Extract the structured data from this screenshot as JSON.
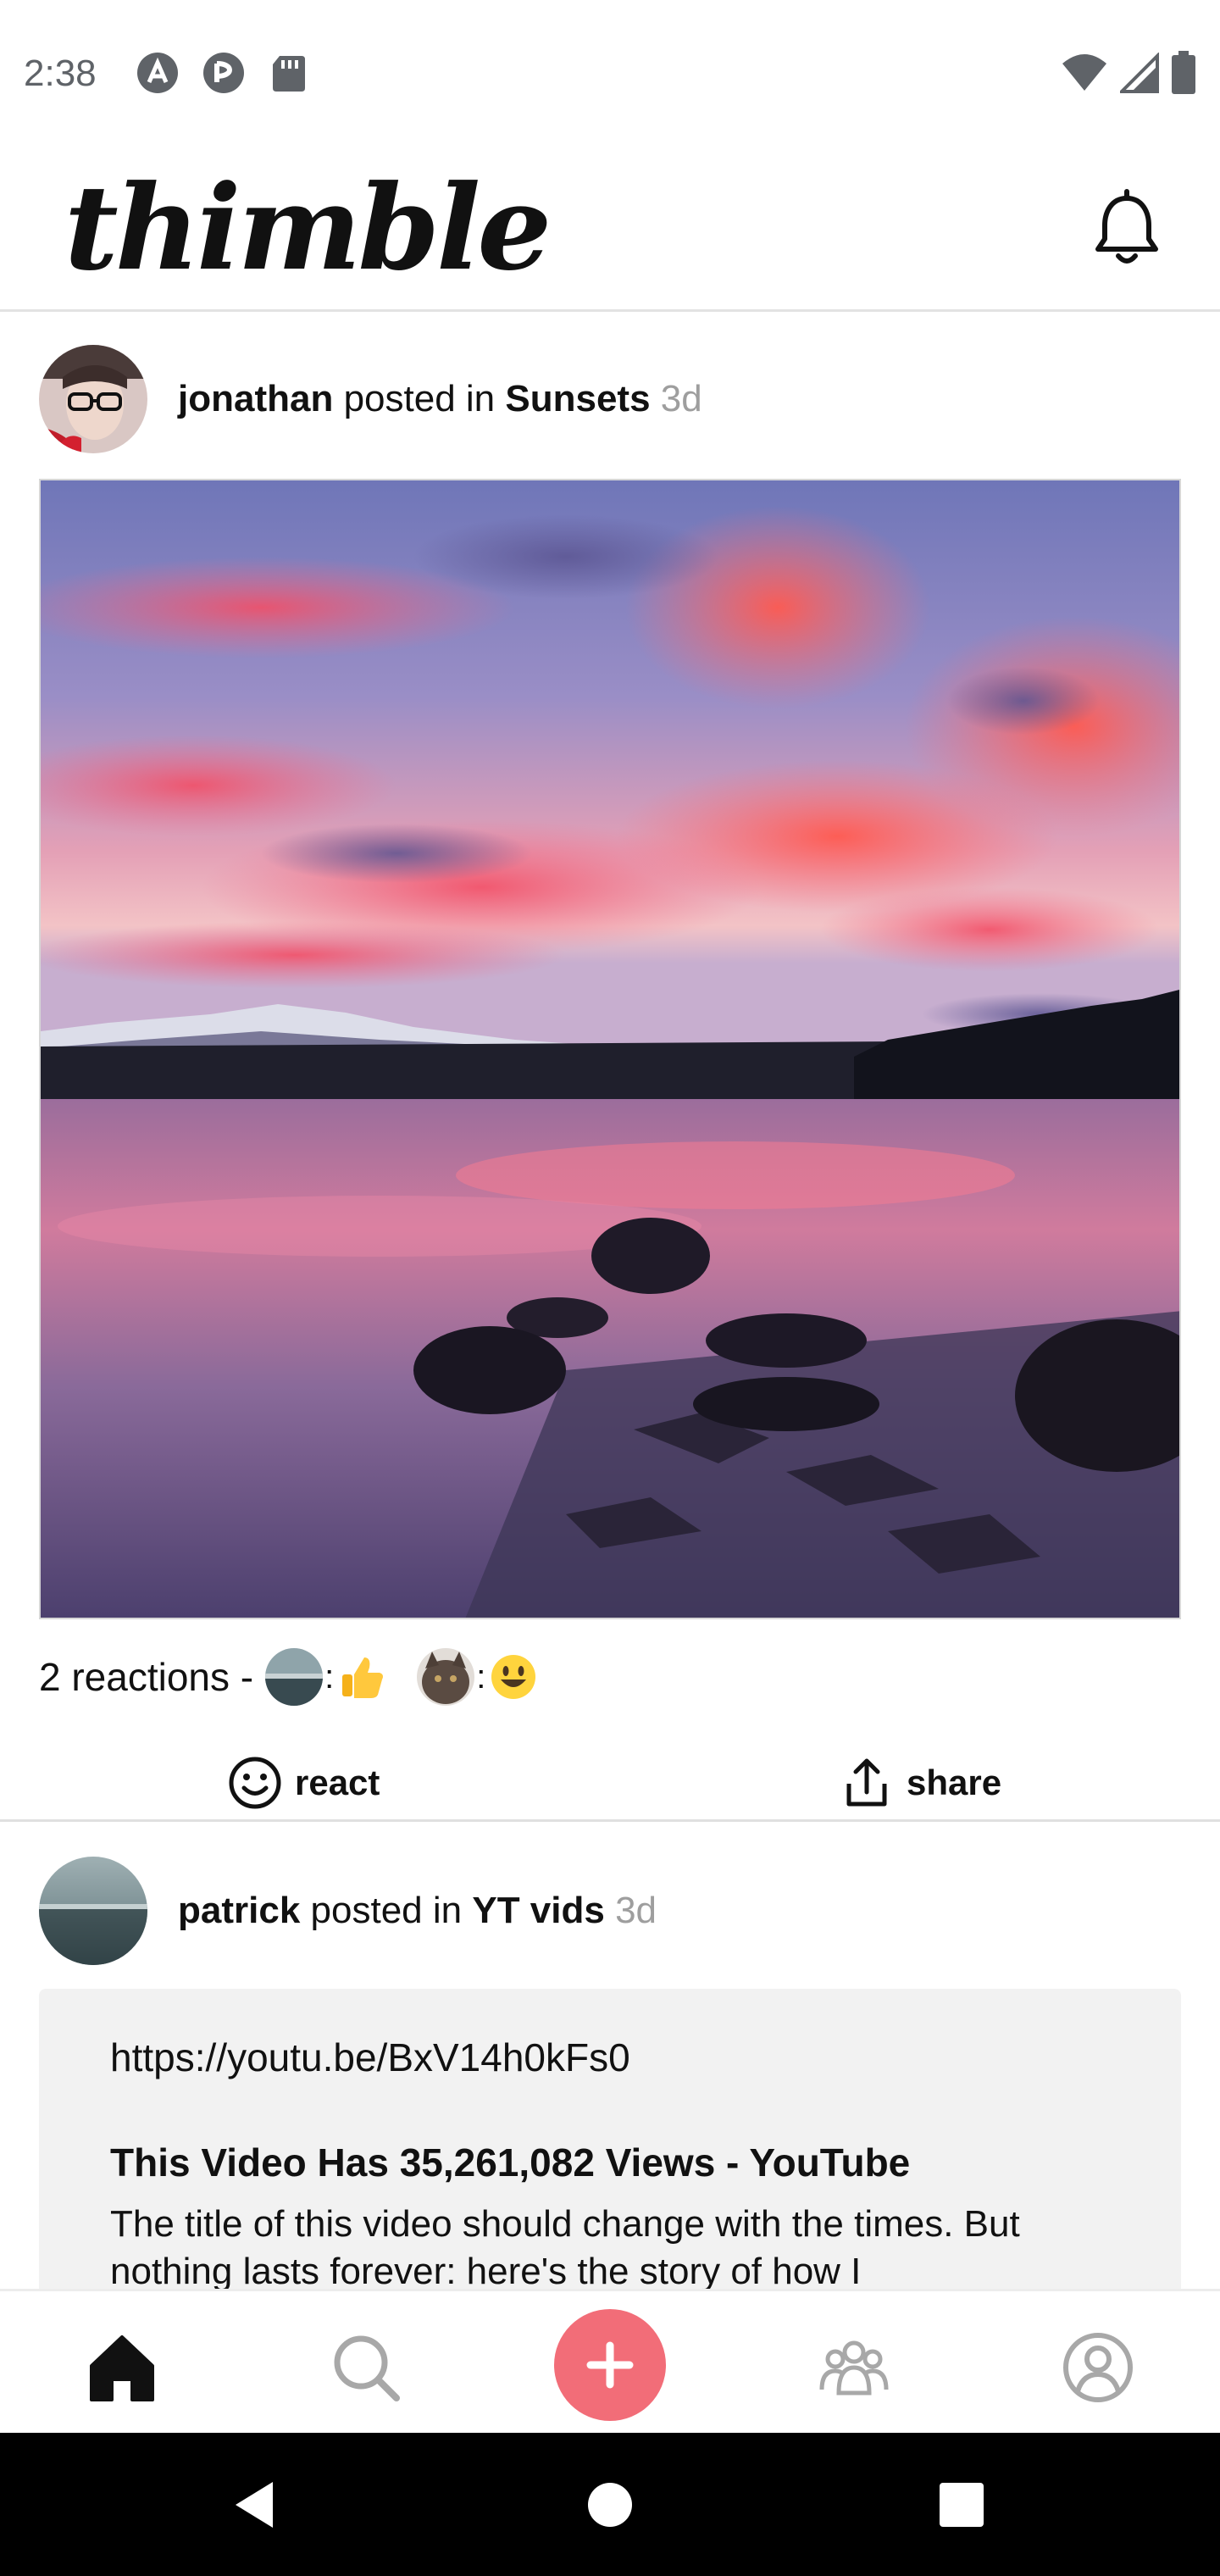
{
  "status_bar": {
    "time": "2:38"
  },
  "header": {
    "logo": "thimble"
  },
  "posts": [
    {
      "author": "jonathan",
      "posted_in": "posted in",
      "group": "Sunsets",
      "age": "3d",
      "reactions_label": "2 reactions -",
      "reactions": [
        {
          "emoji": "👍",
          "avatar": "landscape-avatar"
        },
        {
          "emoji": "😃",
          "avatar": "cat-avatar"
        }
      ],
      "react_label": "react",
      "share_label": "share"
    },
    {
      "author": "patrick",
      "posted_in": "posted in",
      "group": "YT vids",
      "age": "3d",
      "link": {
        "url": "https://youtu.be/BxV14h0kFs0",
        "title": "This Video Has 35,261,082 Views - YouTube",
        "description": "The title of this video should change with the times. But nothing lasts forever: here's the story of how I"
      }
    }
  ],
  "colors": {
    "accent": "#f26d78",
    "muted": "#9e9e9e",
    "card_bg": "#f2f2f2"
  },
  "icons": [
    "bell-icon",
    "home-icon",
    "search-icon",
    "plus-icon",
    "groups-icon",
    "profile-icon",
    "react-smile-icon",
    "share-icon",
    "back-icon",
    "home-circle-icon",
    "recents-icon"
  ]
}
